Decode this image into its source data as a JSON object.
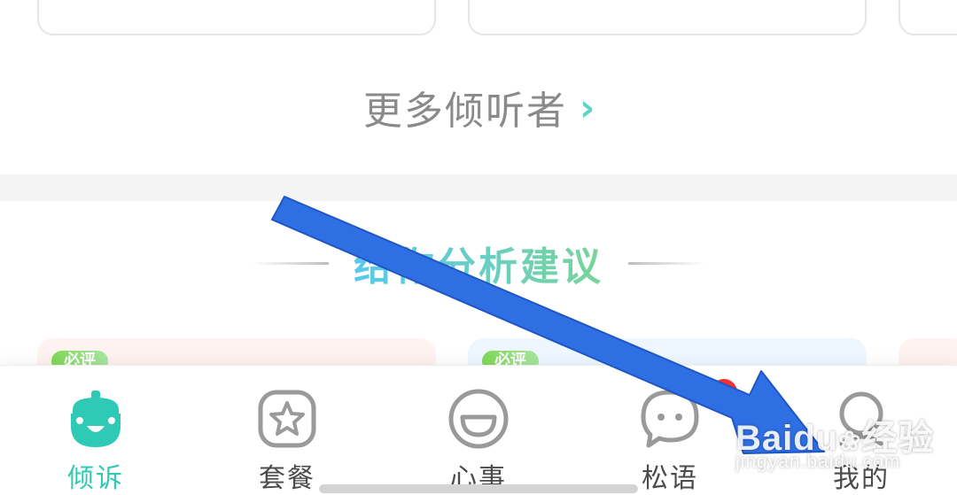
{
  "more_listeners": {
    "label": "更多倾听者",
    "chevron": "›"
  },
  "section": {
    "title": "给你分析建议"
  },
  "promo_tag": "必评",
  "tabs": [
    {
      "label": "倾诉",
      "icon": "acorn-face-icon",
      "active": true
    },
    {
      "label": "套餐",
      "icon": "star-badge-icon",
      "active": false
    },
    {
      "label": "心事",
      "icon": "smile-face-icon",
      "active": false
    },
    {
      "label": "松语",
      "icon": "chat-bubble-icon",
      "active": false
    },
    {
      "label": "我的",
      "icon": "person-icon",
      "active": false
    }
  ],
  "watermark": {
    "brand": "Baidu",
    "brand_cn": "经验",
    "url": "jingyan.baidu.com"
  },
  "colors": {
    "accent": "#2fcab5",
    "annotation_arrow": "#2f6fe4",
    "badge": "#ff2d2d"
  }
}
